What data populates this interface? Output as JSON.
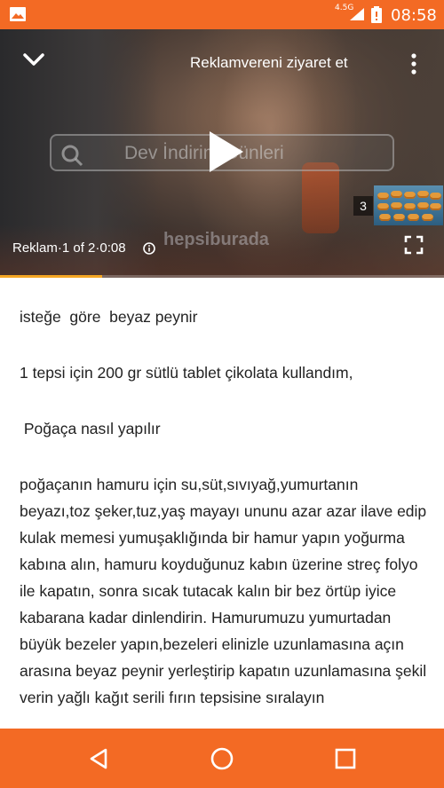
{
  "status_bar": {
    "network": "4.5G",
    "time": "08:58",
    "icons": [
      "gallery-icon",
      "signal-icon",
      "battery-icon"
    ]
  },
  "video": {
    "advertiser_link": "Reklamvereni ziyaret et",
    "ad_counter": "Reklam·1 of 2·0:08",
    "search_text": "Dev İndirim Günleri",
    "logo_text": "hepsiburada",
    "thumbnail_count": "3",
    "progress": 0.23,
    "progress_color": "#f5a623"
  },
  "article": {
    "line1": "isteğe  göre  beyaz peynir",
    "line2": "1 tepsi için 200 gr sütlü tablet çikolata kullandım,",
    "line3": " Poğaça nasıl yapılır",
    "paragraph": "poğaçanın hamuru için su,süt,sıvıyağ,yumurtanın beyazı,toz şeker,tuz,yaş mayayı ununu azar azar ilave edip kulak memesi yumuşaklığında bir hamur yapın yoğurma kabına alın, hamuru koyduğunuz kabın üzerine streç folyo ile kapatın, sonra sıcak tutacak kalın bir bez örtüp iyice kabarana kadar dinlendirin. Hamurumuzu yumurtadan büyük bezeler yapın,bezeleri elinizle uzunlamasına açın arasına beyaz peynir  yerleştirip kapatın uzunlamasına şekil verin yağlı kağıt serili fırın tepsisine sıralayın"
  },
  "colors": {
    "accent": "#f36a24"
  }
}
